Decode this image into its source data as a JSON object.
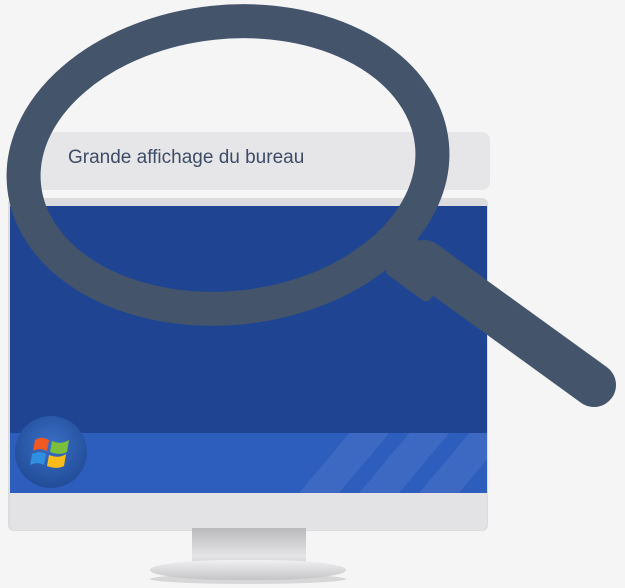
{
  "label": {
    "text": "Grande affichage du bureau"
  },
  "icons": {
    "start": "windows-start-orb-icon",
    "magnifier": "magnifying-glass-icon"
  },
  "colors": {
    "background": "#f5f5f6",
    "screen": "#1f4592",
    "taskbar": "#2d5dbd",
    "magnifier": "#44546b",
    "label_text": "#3d4d66"
  }
}
